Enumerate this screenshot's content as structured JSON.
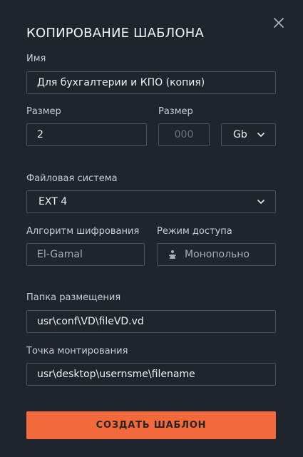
{
  "dialog": {
    "title": "КОПИРОВАНИЕ ШАБЛОНА",
    "close_icon": "close-icon"
  },
  "form": {
    "name": {
      "label": "Имя",
      "value": "Для бухгалтерии и КПО (копия)"
    },
    "size_main": {
      "label": "Размер",
      "value": "2"
    },
    "size_extra": {
      "label": "Размер",
      "placeholder": "000",
      "unit": "Gb"
    },
    "filesystem": {
      "label": "Файловая система",
      "value": "EXT 4"
    },
    "encryption": {
      "label": "Алгоритм шифрования",
      "value": "El-Gamal"
    },
    "access_mode": {
      "label": "Режим доступа",
      "value": "Монопольно",
      "icon": "person-icon"
    },
    "folder": {
      "label": "Папка размещения",
      "value": "usr\\conf\\VD\\fileVD.vd"
    },
    "mount_point": {
      "label": "Точка монтирования",
      "value": "usr\\desktop\\usernsme\\filename"
    }
  },
  "actions": {
    "create_label": "СОЗДАТЬ ШАБЛОН"
  },
  "colors": {
    "background": "#1f252c",
    "border": "#4a525b",
    "accent": "#f26a3c",
    "text": "#eef1f4",
    "label": "#c8ced4"
  }
}
